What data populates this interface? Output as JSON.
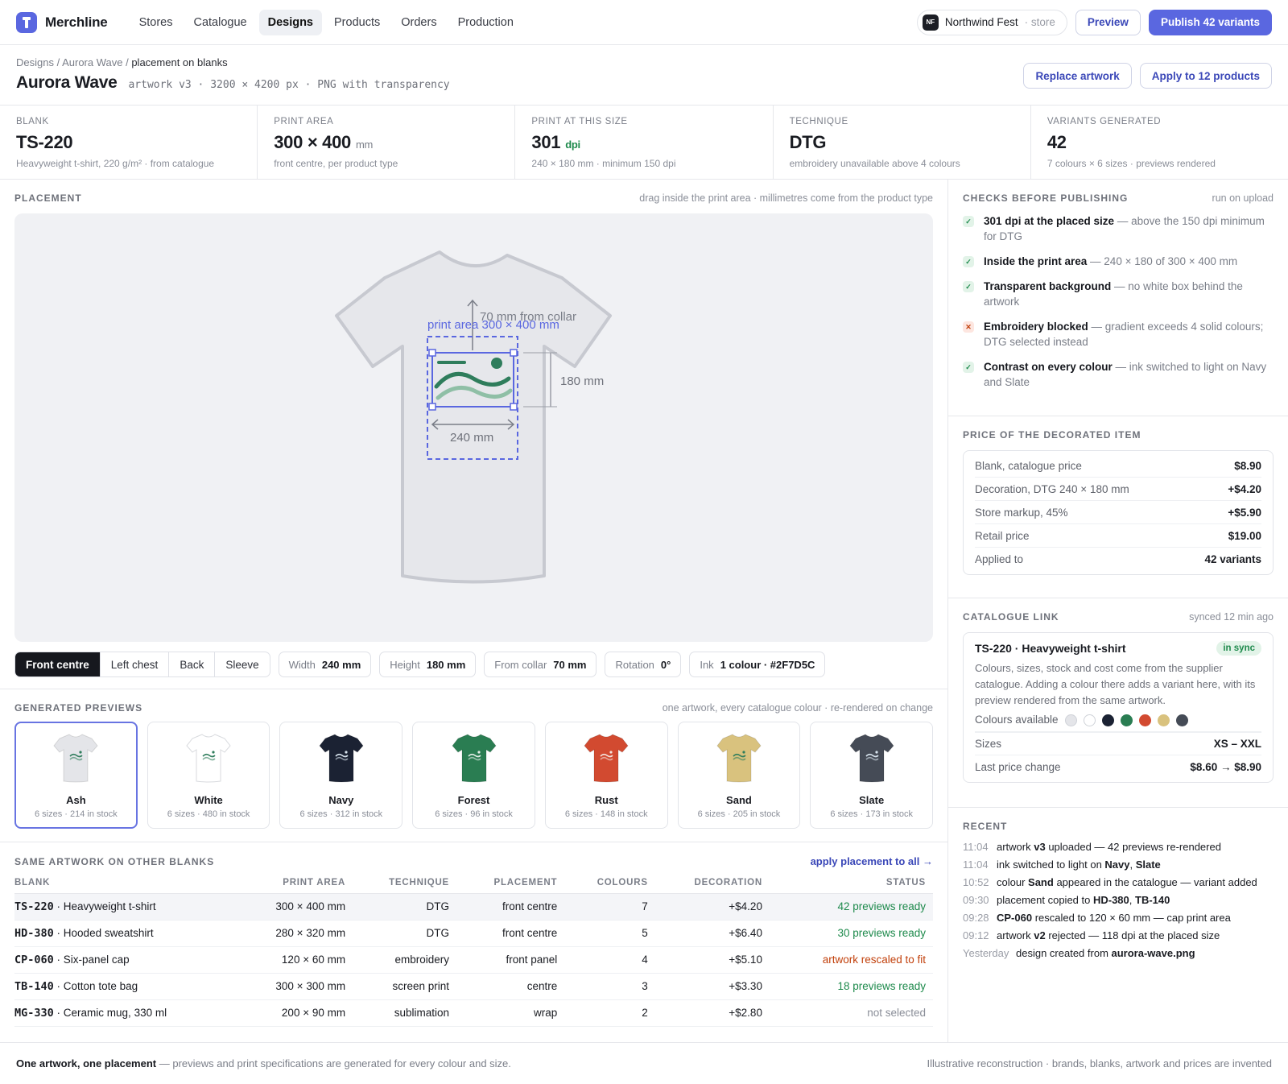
{
  "app": {
    "name": "Merchline"
  },
  "nav": [
    {
      "label": "Stores"
    },
    {
      "label": "Catalogue"
    },
    {
      "label": "Designs",
      "active": true
    },
    {
      "label": "Products"
    },
    {
      "label": "Orders"
    },
    {
      "label": "Production"
    }
  ],
  "store": {
    "initials": "NF",
    "name": "Northwind Fest",
    "sub": "· store"
  },
  "topbar": {
    "preview": "Preview",
    "publish": "Publish 42 variants"
  },
  "breadcrumb": {
    "part1": "Designs",
    "sep": " / ",
    "part2": "Aurora Wave",
    "current": "placement on blanks"
  },
  "design": {
    "title": "Aurora Wave",
    "meta": "artwork v3 · 3200 × 4200 px · PNG with transparency"
  },
  "head_actions": {
    "replace": "Replace artwork",
    "apply": "Apply to 12 products"
  },
  "stats": [
    {
      "label": "BLANK",
      "value": "TS-220",
      "unit": "",
      "sub": "Heavyweight t-shirt, 220 g/m² · from catalogue"
    },
    {
      "label": "PRINT AREA",
      "value": "300 × 400",
      "unit": "mm",
      "sub": "front centre, per product type"
    },
    {
      "label": "PRINT AT THIS SIZE",
      "value": "301",
      "unit": "dpi",
      "sub": "240 × 180 mm · minimum 150 dpi"
    },
    {
      "label": "TECHNIQUE",
      "value": "DTG",
      "unit": "",
      "sub": "embroidery unavailable above 4 colours"
    },
    {
      "label": "VARIANTS GENERATED",
      "value": "42",
      "unit": "",
      "sub": "7 colours × 6 sizes · previews rendered"
    }
  ],
  "placement": {
    "label": "PLACEMENT",
    "hint": "drag inside the print area · millimetres come from the product type",
    "canvas": {
      "collar_label": "70 mm from collar",
      "area_label": "print area 300 × 400 mm",
      "height_label": "180 mm",
      "width_label": "240 mm"
    },
    "positions": [
      "Front centre",
      "Left chest",
      "Back",
      "Sleeve"
    ],
    "active_position": "Front centre",
    "fields": [
      {
        "k": "Width",
        "v": "240 mm"
      },
      {
        "k": "Height",
        "v": "180 mm"
      },
      {
        "k": "From collar",
        "v": "70 mm"
      },
      {
        "k": "Rotation",
        "v": "0°"
      },
      {
        "k": "Ink",
        "v": "1 colour · #2F7D5C"
      }
    ],
    "ink_color": "#2F7D5C",
    "accent": "#5A67E0"
  },
  "previews": {
    "label": "GENERATED PREVIEWS",
    "hint": "one artwork, every catalogue colour · re-rendered on change",
    "items": [
      {
        "name": "Ash",
        "sub": "6 sizes · 214 in stock",
        "color": "#E4E5E9",
        "ink": "#2F7D5C",
        "active": true
      },
      {
        "name": "White",
        "sub": "6 sizes · 480 in stock",
        "color": "#FFFFFF",
        "ink": "#2F7D5C"
      },
      {
        "name": "Navy",
        "sub": "6 sizes · 312 in stock",
        "color": "#1B2233",
        "ink": "#D8E4EE"
      },
      {
        "name": "Forest",
        "sub": "6 sizes · 96 in stock",
        "color": "#2A7D52",
        "ink": "#E6EFE9"
      },
      {
        "name": "Rust",
        "sub": "6 sizes · 148 in stock",
        "color": "#D24A30",
        "ink": "#F3E4DE"
      },
      {
        "name": "Sand",
        "sub": "6 sizes · 205 in stock",
        "color": "#D9C27E",
        "ink": "#2F7D5C"
      },
      {
        "name": "Slate",
        "sub": "6 sizes · 173 in stock",
        "color": "#454B56",
        "ink": "#D8E4EE"
      }
    ]
  },
  "blanks": {
    "label": "SAME ARTWORK ON OTHER BLANKS",
    "action": "apply placement to all →",
    "columns": [
      "BLANK",
      "PRINT AREA",
      "TECHNIQUE",
      "PLACEMENT",
      "COLOURS",
      "DECORATION",
      "STATUS"
    ],
    "rows": [
      {
        "code": "TS-220",
        "name": "· Heavyweight t-shirt",
        "area": "300 × 400 mm",
        "tech": "DTG",
        "place": "front centre",
        "colours": "7",
        "deco": "+$4.20",
        "status": "42 previews ready",
        "tone": "green"
      },
      {
        "code": "HD-380",
        "name": "· Hooded sweatshirt",
        "area": "280 × 320 mm",
        "tech": "DTG",
        "place": "front centre",
        "colours": "5",
        "deco": "+$6.40",
        "status": "30 previews ready",
        "tone": "green"
      },
      {
        "code": "CP-060",
        "name": "· Six-panel cap",
        "area": "120 × 60 mm",
        "tech": "embroidery",
        "place": "front panel",
        "colours": "4",
        "deco": "+$5.10",
        "status": "artwork rescaled to fit",
        "tone": "red"
      },
      {
        "code": "TB-140",
        "name": "· Cotton tote bag",
        "area": "300 × 300 mm",
        "tech": "screen print",
        "place": "centre",
        "colours": "3",
        "deco": "+$3.30",
        "status": "18 previews ready",
        "tone": "green"
      },
      {
        "code": "MG-330",
        "name": "· Ceramic mug, 330 ml",
        "area": "200 × 90 mm",
        "tech": "sublimation",
        "place": "wrap",
        "colours": "2",
        "deco": "+$2.80",
        "status": "not selected",
        "tone": "grey"
      }
    ]
  },
  "checks": {
    "label": "CHECKS BEFORE PUBLISHING",
    "hint": "run on upload",
    "items": [
      {
        "ok": true,
        "title": "301 dpi at the placed size",
        "rest": " — above the 150 dpi minimum for DTG"
      },
      {
        "ok": true,
        "title": "Inside the print area",
        "rest": " — 240 × 180 of 300 × 400 mm"
      },
      {
        "ok": true,
        "title": "Transparent background",
        "rest": " — no white box behind the artwork"
      },
      {
        "ok": false,
        "title": "Embroidery blocked",
        "rest": " — gradient exceeds 4 solid colours; DTG selected instead"
      },
      {
        "ok": true,
        "title": "Contrast on every colour",
        "rest": " — ink switched to light on Navy and Slate"
      }
    ]
  },
  "price": {
    "label": "PRICE OF THE DECORATED ITEM",
    "rows": [
      {
        "k": "Blank, catalogue price",
        "v": "$8.90"
      },
      {
        "k": "Decoration, DTG 240 × 180 mm",
        "v": "+$4.20"
      },
      {
        "k": "Store markup, 45%",
        "v": "+$5.90"
      },
      {
        "k": "Retail price",
        "v": "$19.00"
      },
      {
        "k": "Applied to",
        "v": "42 variants"
      }
    ]
  },
  "catalogue": {
    "label": "CATALOGUE LINK",
    "hint": "synced 12 min ago",
    "title": "TS-220 · Heavyweight t-shirt",
    "badge": "in sync",
    "desc": "Colours, sizes, stock and cost come from the supplier catalogue. Adding a colour there adds a variant here, with its preview rendered from the same artwork.",
    "colours_label": "Colours available",
    "swatches": [
      "#E4E5E9",
      "#FFFFFF",
      "#1B2233",
      "#2A7D52",
      "#D24A30",
      "#D9C27E",
      "#454B56"
    ],
    "rows": [
      {
        "k": "Sizes",
        "v": "XS – XXL"
      },
      {
        "k": "Last price change",
        "v": "$8.60 → $8.90"
      }
    ]
  },
  "recent": {
    "label": "RECENT",
    "items": [
      {
        "t": "11:04",
        "html": "artwork <b>v3</b> uploaded — 42 previews re-rendered"
      },
      {
        "t": "11:04",
        "html": "ink switched to light on <b>Navy</b>, <b>Slate</b>"
      },
      {
        "t": "10:52",
        "html": "colour <b>Sand</b> appeared in the catalogue — variant added"
      },
      {
        "t": "09:30",
        "html": "placement copied to <b>HD-380</b>, <b>TB-140</b>"
      },
      {
        "t": "09:28",
        "html": "<b>CP-060</b> rescaled to 120 × 60 mm — cap print area"
      },
      {
        "t": "09:12",
        "html": "artwork <b>v2</b> rejected — 118 dpi at the placed size"
      },
      {
        "t": "Yesterday",
        "html": "design created from <b>aurora-wave.png</b>"
      }
    ]
  },
  "footer": {
    "left_bold": "One artwork, one placement",
    "left_rest": " — previews and print specifications are generated for every colour and size.",
    "right": "Illustrative reconstruction · brands, blanks, artwork and prices are invented"
  }
}
